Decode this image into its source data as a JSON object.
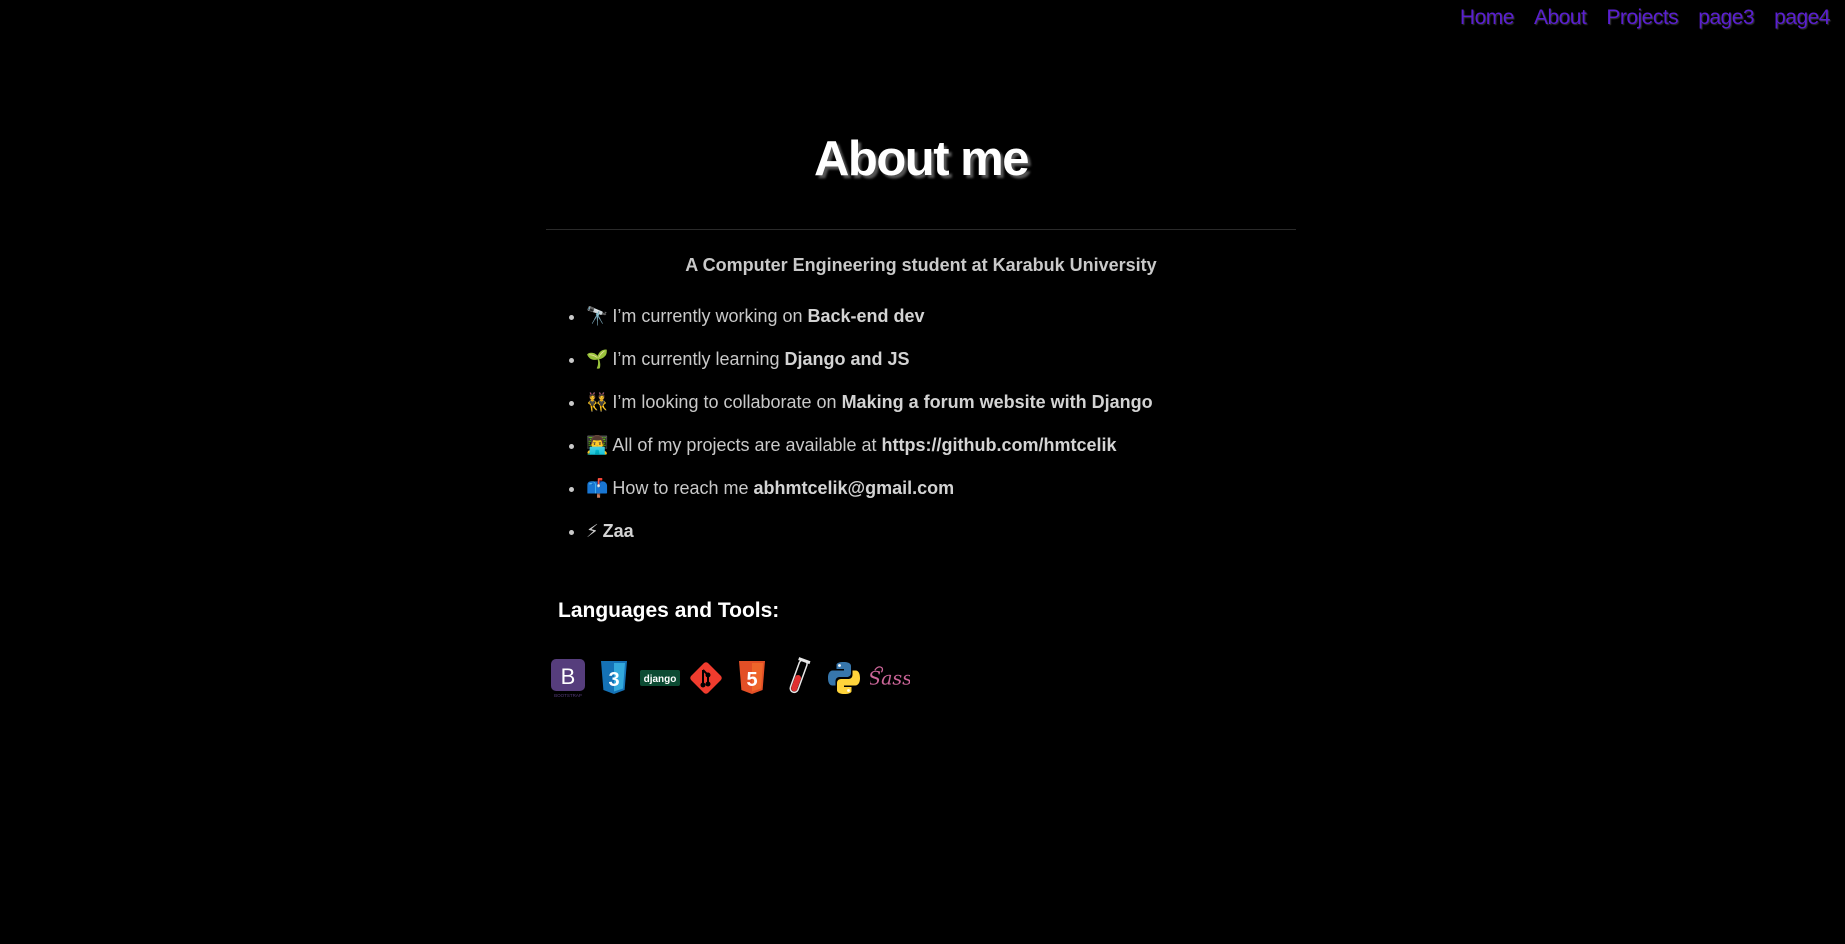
{
  "nav": {
    "items": [
      "Home",
      "About",
      "Projects",
      "page3",
      "page4"
    ]
  },
  "page": {
    "title": "About me",
    "subtitle": "A Computer Engineering student at Karabuk University"
  },
  "facts": [
    {
      "emoji": "🔭",
      "text": "I’m currently working on ",
      "bold": "Back-end dev"
    },
    {
      "emoji": "🌱",
      "text": "I’m currently learning ",
      "bold": "Django and JS"
    },
    {
      "emoji": "👯",
      "text": "I’m looking to collaborate on ",
      "bold": "Making a forum website with Django"
    },
    {
      "emoji": "👨‍💻",
      "text": "All of my projects are available at ",
      "bold": "https://github.com/hmtcelik"
    },
    {
      "emoji": "📫",
      "text": "How to reach me ",
      "bold": "abhmtcelik@gmail.com"
    },
    {
      "emoji": "⚡",
      "text": "",
      "bold": "Zaa"
    }
  ],
  "tools": {
    "heading": "Languages and Tools:",
    "icons": [
      {
        "name": "bootstrap-icon",
        "letter": "B",
        "sub": "BOOTSTRAP",
        "color": "#563d7c"
      },
      {
        "name": "css3-icon",
        "letter": "3",
        "color": "#1572b6"
      },
      {
        "name": "django-icon",
        "letter": "django",
        "color": "#0c4b33"
      },
      {
        "name": "git-icon",
        "color": "#f03c2e"
      },
      {
        "name": "html5-icon",
        "letter": "5",
        "color": "#e34f26"
      },
      {
        "name": "testtube-icon",
        "color": "#e03030"
      },
      {
        "name": "python-icon",
        "color": "#3776ab"
      },
      {
        "name": "sass-icon",
        "letter": "Sass",
        "color": "#cc6699"
      }
    ]
  }
}
